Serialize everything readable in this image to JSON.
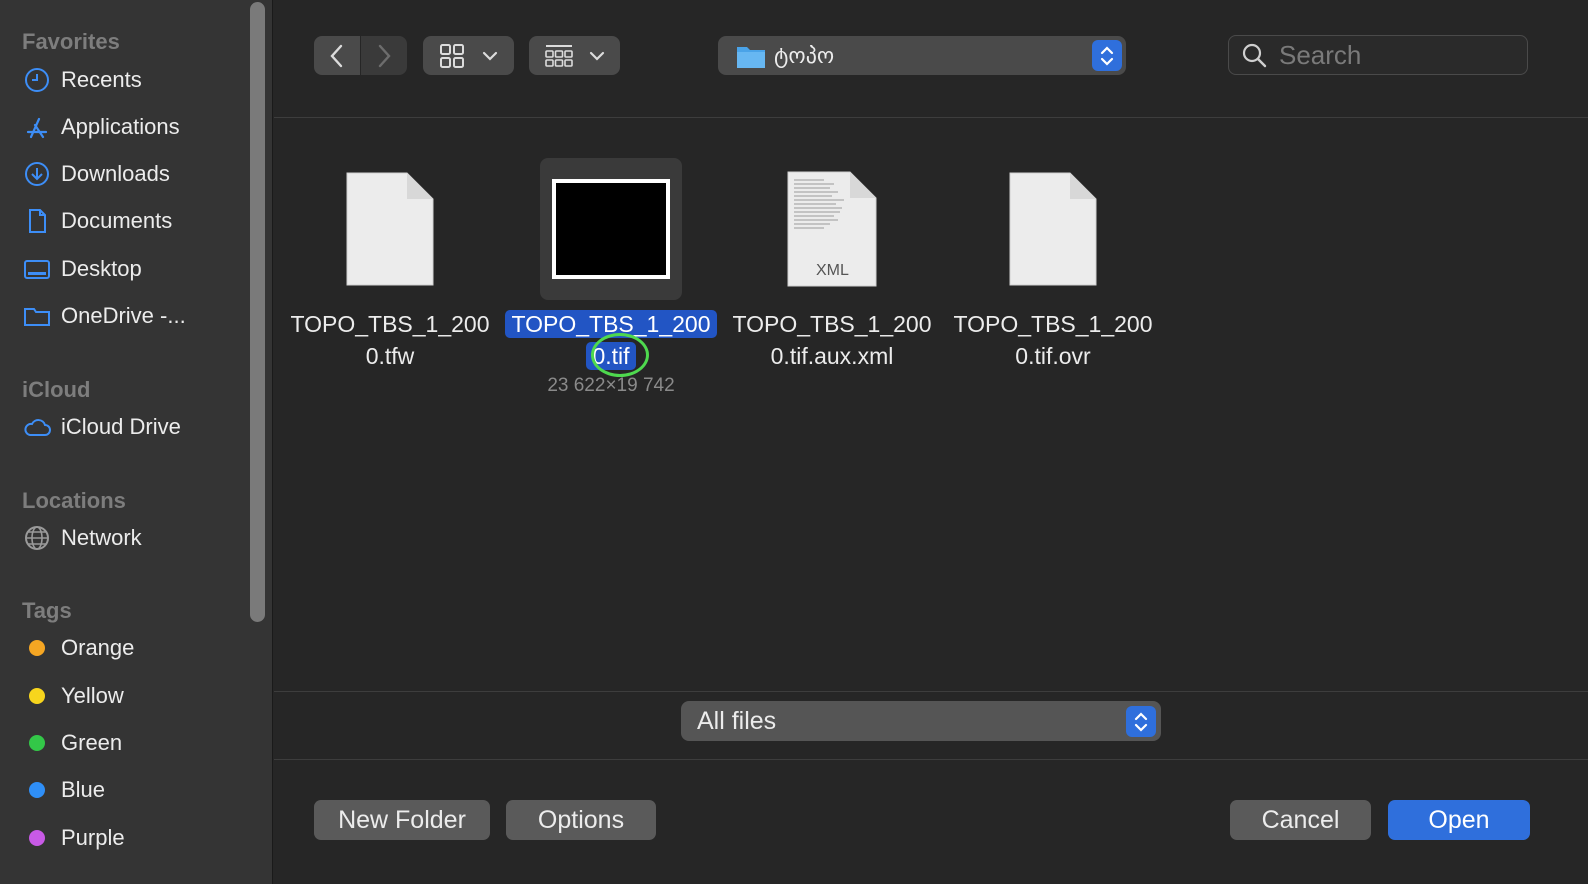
{
  "sidebar": {
    "favorites_header": "Favorites",
    "favorites": [
      {
        "label": "Recents",
        "icon": "clock-icon"
      },
      {
        "label": "Applications",
        "icon": "applications-icon"
      },
      {
        "label": "Downloads",
        "icon": "download-icon"
      },
      {
        "label": "Documents",
        "icon": "document-icon"
      },
      {
        "label": "Desktop",
        "icon": "desktop-icon"
      },
      {
        "label": "OneDrive -...",
        "icon": "folder-icon"
      }
    ],
    "icloud_header": "iCloud",
    "icloud": [
      {
        "label": "iCloud Drive",
        "icon": "cloud-icon"
      }
    ],
    "locations_header": "Locations",
    "locations": [
      {
        "label": "Network",
        "icon": "globe-icon"
      }
    ],
    "tags_header": "Tags",
    "tags": [
      {
        "label": "Orange",
        "color": "#f5a623"
      },
      {
        "label": "Yellow",
        "color": "#f7d51d"
      },
      {
        "label": "Green",
        "color": "#33c748"
      },
      {
        "label": "Blue",
        "color": "#2f8ff7"
      },
      {
        "label": "Purple",
        "color": "#c85ae6"
      }
    ]
  },
  "toolbar": {
    "current_folder": "ტოპო",
    "search_placeholder": "Search"
  },
  "files": [
    {
      "name_line1": "TOPO_TBS_1_200",
      "name_line2": "0.tfw",
      "type": "generic-file-icon",
      "selected": false
    },
    {
      "name_line1": "TOPO_TBS_1_200",
      "name_line2": "0.tif",
      "meta": "23 622×19 742",
      "type": "image-thumbnail",
      "selected": true
    },
    {
      "name_line1": "TOPO_TBS_1_200",
      "name_line2": "0.tif.aux.xml",
      "badge": "XML",
      "type": "xml-file-icon",
      "selected": false
    },
    {
      "name_line1": "TOPO_TBS_1_200",
      "name_line2": "0.tif.ovr",
      "type": "generic-file-icon",
      "selected": false
    }
  ],
  "filter": {
    "value": "All files"
  },
  "buttons": {
    "new_folder": "New Folder",
    "options": "Options",
    "cancel": "Cancel",
    "open": "Open"
  },
  "colors": {
    "accent": "#2f6fdc",
    "selection": "#2255c4",
    "click_marker": "#4ed94e"
  }
}
